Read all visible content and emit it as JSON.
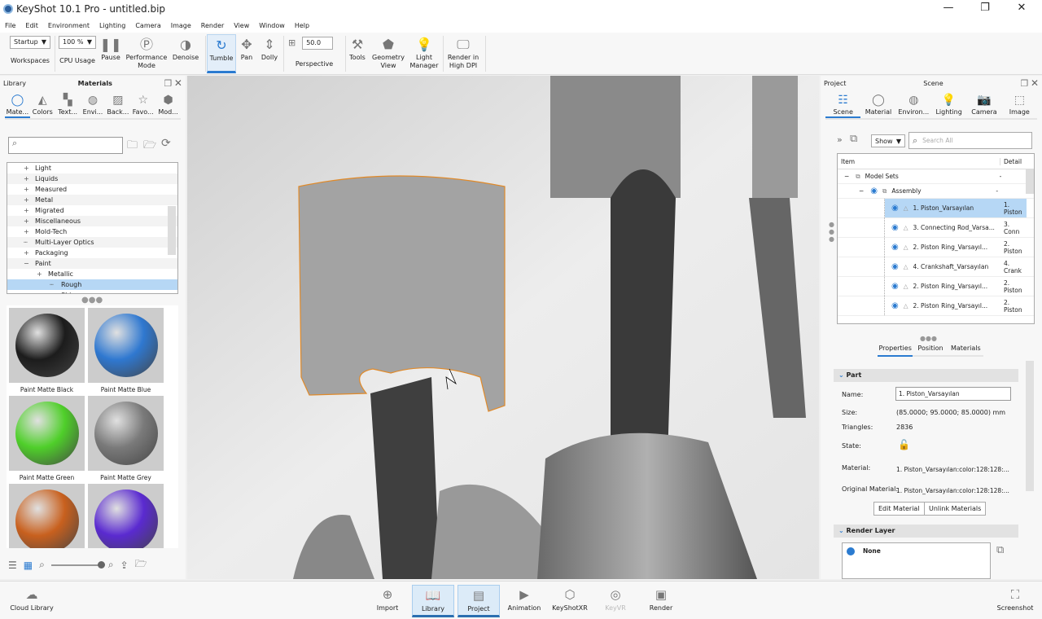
{
  "title": "KeyShot 10.1 Pro  - untitled.bip",
  "menu": [
    "File",
    "Edit",
    "Environment",
    "Lighting",
    "Camera",
    "Image",
    "Render",
    "View",
    "Window",
    "Help"
  ],
  "toolbar": {
    "workspace_value": "Startup",
    "workspaces": "Workspaces",
    "cpu_value": "100 %",
    "cpu": "CPU Usage",
    "pause": "Pause",
    "performance": "Performance Mode",
    "denoise": "Denoise",
    "tumble": "Tumble",
    "pan": "Pan",
    "dolly": "Dolly",
    "fov_value": "50.0",
    "perspective": "Perspective",
    "tools": "Tools",
    "geometry": "Geometry View",
    "light": "Light Manager",
    "hidpi": "Render in High DPI"
  },
  "library": {
    "left": "Library",
    "title": "Materials",
    "tabs": [
      "Mate...",
      "Colors",
      "Text...",
      "Envi...",
      "Back...",
      "Favo...",
      "Mod..."
    ],
    "tree": [
      {
        "l": "Light",
        "s": "+",
        "d": 0
      },
      {
        "l": "Liquids",
        "s": "+",
        "d": 0
      },
      {
        "l": "Measured",
        "s": "+",
        "d": 0
      },
      {
        "l": "Metal",
        "s": "+",
        "d": 0
      },
      {
        "l": "Migrated",
        "s": "+",
        "d": 0
      },
      {
        "l": "Miscellaneous",
        "s": "+",
        "d": 0
      },
      {
        "l": "Mold-Tech",
        "s": "+",
        "d": 0
      },
      {
        "l": "Multi-Layer Optics",
        "s": "┄",
        "d": 0
      },
      {
        "l": "Packaging",
        "s": "+",
        "d": 0
      },
      {
        "l": "Paint",
        "s": "−",
        "d": 0
      },
      {
        "l": "Metallic",
        "s": "+",
        "d": 1
      },
      {
        "l": "Rough",
        "s": "┄",
        "d": 2,
        "hl": true
      },
      {
        "l": "Shiny",
        "s": "┄",
        "d": 2
      }
    ],
    "swatches": [
      {
        "name": "Paint Matte Black",
        "color": "#1c1c1c"
      },
      {
        "name": "Paint Matte Blue",
        "color": "#2f78d0"
      },
      {
        "name": "Paint Matte Green",
        "color": "#4fcf2a"
      },
      {
        "name": "Paint Matte Grey",
        "color": "#7a7a7a"
      },
      {
        "name": "",
        "color": "#c8601e"
      },
      {
        "name": "",
        "color": "#5a2ad0"
      }
    ]
  },
  "project": {
    "left": "Project",
    "title": "Scene",
    "tabs": [
      "Scene",
      "Material",
      "Environ...",
      "Lighting",
      "Camera",
      "Image"
    ],
    "show": "Show",
    "search_placeholder": "Search All",
    "col_item": "Item",
    "col_detail": "Detail",
    "model_sets": "Model Sets",
    "assembly": "Assembly",
    "dash": "-",
    "rows": [
      {
        "item": "1. Piston_Varsayılan",
        "detail": "1. Piston"
      },
      {
        "item": "3. Connecting Rod_Varsa...",
        "detail": "3. Conn"
      },
      {
        "item": "2. Piston Ring_Varsayıl...",
        "detail": "2. Piston"
      },
      {
        "item": "4. Crankshaft_Varsayılan",
        "detail": "4. Crank"
      },
      {
        "item": "2. Piston Ring_Varsayıl...",
        "detail": "2. Piston"
      },
      {
        "item": "2. Piston Ring_Varsayıl...",
        "detail": "2. Piston"
      }
    ],
    "subtabs": [
      "Properties",
      "Position",
      "Materials"
    ],
    "part": "Part",
    "name_label": "Name:",
    "name_value": "1. Piston_Varsayılan",
    "size_label": "Size:",
    "size_value": "(85.0000; 95.0000; 85.0000) mm",
    "tri_label": "Triangles:",
    "tri_value": "2836",
    "state_label": "State:",
    "mat_label": "Material:",
    "mat_value": "1. Piston_Varsayılan:color:128:128:...",
    "orig_label": "Original Material:",
    "orig_value": "1. Piston_Varsayılan:color:128:128:...",
    "edit": "Edit Material",
    "unlink": "Unlink Materials",
    "render_layer": "Render Layer",
    "layer_none": "None"
  },
  "bottom": {
    "cloud": "Cloud Library",
    "items": [
      "Import",
      "Library",
      "Project",
      "Animation",
      "KeyShotXR",
      "KeyVR",
      "Render"
    ],
    "screenshot": "Screenshot"
  },
  "colors": {
    "accent": "#2b7bd0",
    "selection": "#b6d7f5",
    "outline": "#e08a2a"
  }
}
